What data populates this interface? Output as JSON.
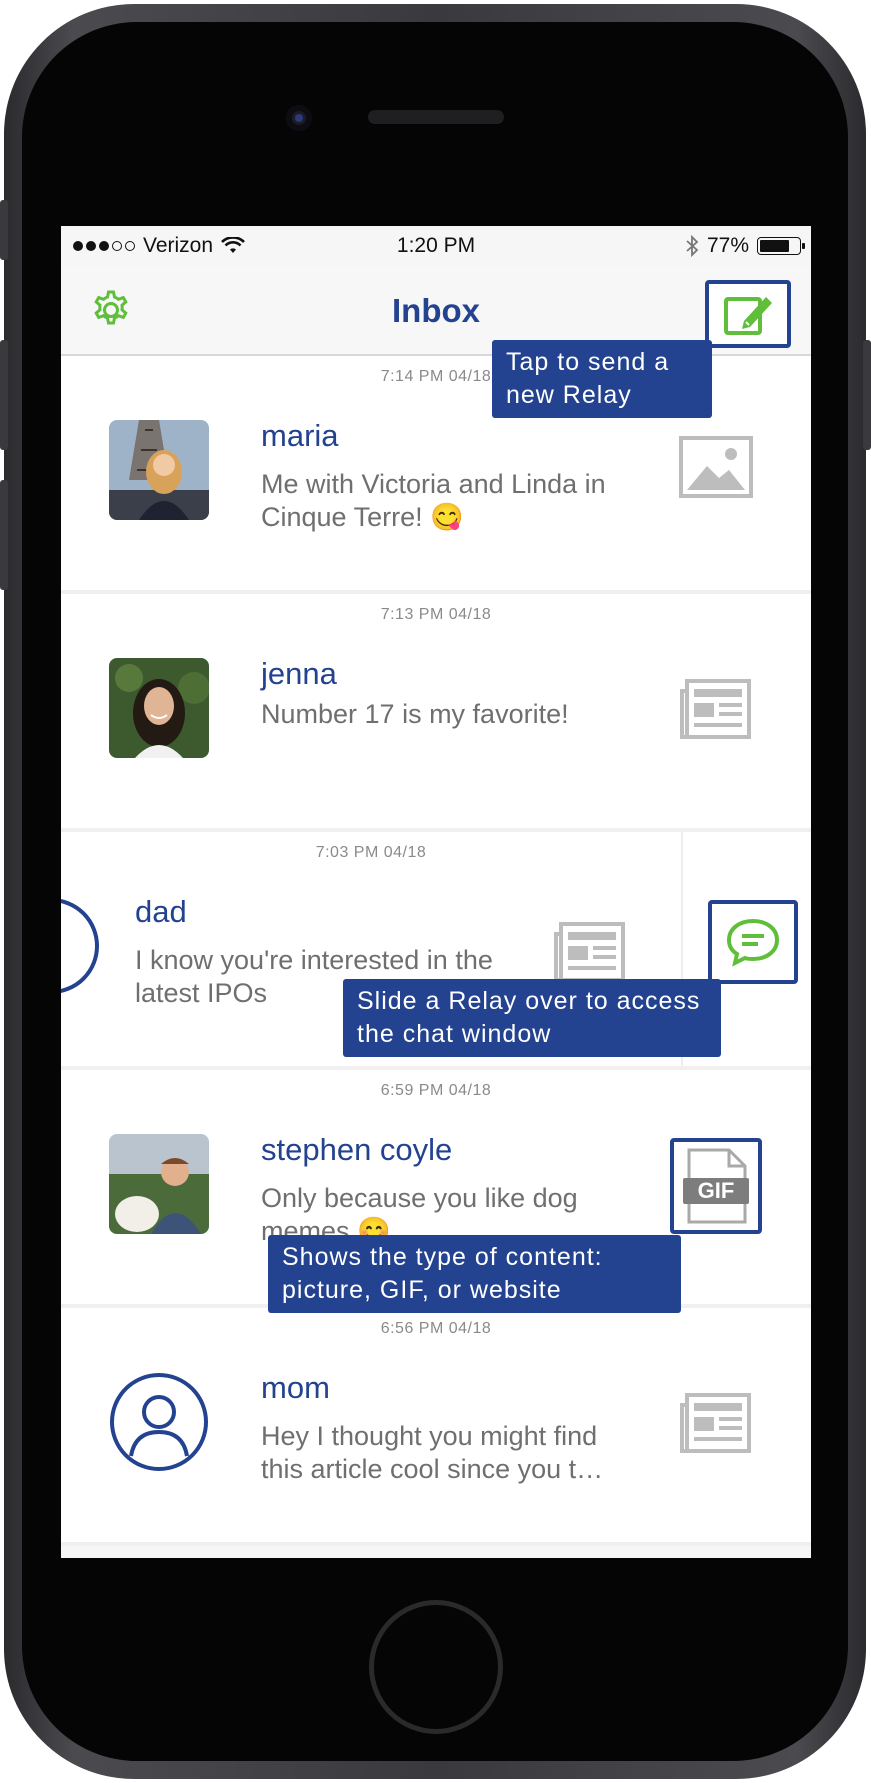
{
  "status_bar": {
    "carrier": "Verizon",
    "time": "1:20 PM",
    "battery": "77%",
    "battery_level": 0.77,
    "signal_bars_filled": 3,
    "signal_bars_total": 5
  },
  "nav": {
    "title": "Inbox",
    "settings_icon": "gear-icon",
    "compose_icon": "compose-icon"
  },
  "colors": {
    "brand_blue": "#23428f",
    "accent_green": "#5fbf3a",
    "muted_gray": "#bdbdbd"
  },
  "messages": [
    {
      "timestamp": "7:14 PM  04/18",
      "sender": "maria",
      "preview": "Me with Victoria and Linda in Cinque Terre! 😋",
      "content_type": "picture",
      "type_icon": "image-icon",
      "avatar": "photo"
    },
    {
      "timestamp": "7:13 PM  04/18",
      "sender": "jenna",
      "preview": "Number 17 is my favorite!",
      "content_type": "website",
      "type_icon": "article-icon",
      "avatar": "photo"
    },
    {
      "timestamp": "7:03 PM  04/18",
      "sender": "dad",
      "preview": "I know you're interested in the latest IPOs",
      "content_type": "website",
      "type_icon": "article-icon",
      "avatar": "default-user"
    },
    {
      "timestamp": "6:59 PM  04/18",
      "sender": "stephen coyle",
      "preview": "Only because you like dog memes 😊",
      "content_type": "gif",
      "type_icon": "gif-file-icon",
      "avatar": "photo"
    },
    {
      "timestamp": "6:56 PM  04/18",
      "sender": "mom",
      "preview": "Hey I thought you might find this article cool since you t…",
      "content_type": "website",
      "type_icon": "article-icon",
      "avatar": "default-user"
    }
  ],
  "callouts": {
    "compose": "Tap to send a new Relay",
    "slide": "Slide a Relay over to access the chat window",
    "content_type": "Shows the type of content: picture, GIF, or website"
  },
  "chat_icon": "chat-bubble-icon"
}
